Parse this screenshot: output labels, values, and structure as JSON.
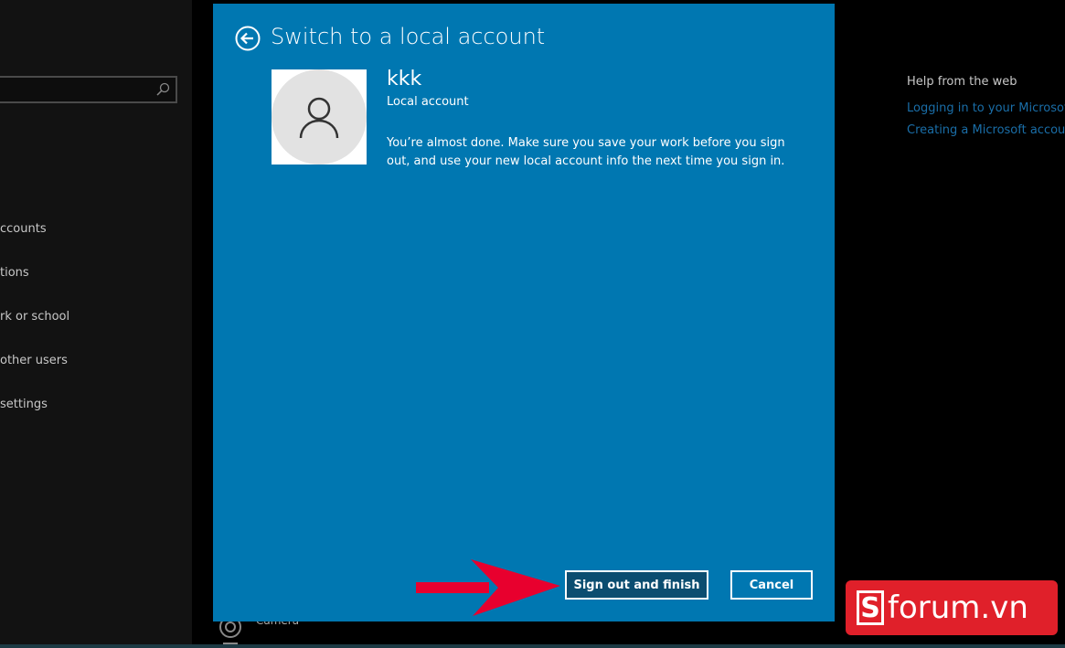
{
  "sidebar": {
    "search_placeholder": "",
    "items": [
      "ccounts",
      "tions",
      "rk or school",
      "other users",
      "settings"
    ]
  },
  "help": {
    "title": "Help from the web",
    "links": [
      "Logging in to your Microsoft",
      "Creating a Microsoft account"
    ]
  },
  "camera_label": "Camera",
  "dialog": {
    "title": "Switch to a local account",
    "user_name": "kkk",
    "account_type": "Local account",
    "message": "You’re almost done. Make sure you save your work before you sign out, and use your new local account info the next time you sign in.",
    "primary_button": "Sign out and finish",
    "cancel_button": "Cancel",
    "bg_color": "#0077b1"
  },
  "watermark": {
    "text": "forum.vn",
    "letter": "S",
    "color": "#e0202a"
  }
}
